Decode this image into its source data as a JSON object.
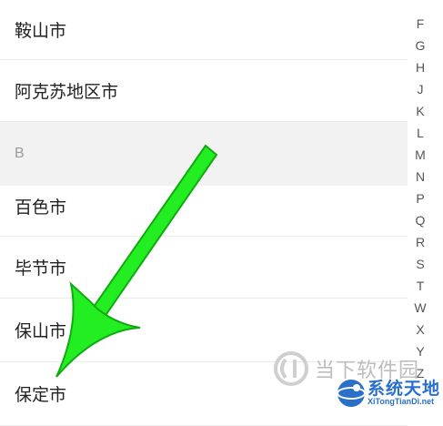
{
  "cities_a": [
    "鞍山市",
    "阿克苏地区市"
  ],
  "section_b": "B",
  "cities_b": [
    "百色市",
    "毕节市",
    "保山市",
    "保定市"
  ],
  "index_letters": [
    "F",
    "G",
    "H",
    "J",
    "K",
    "L",
    "M",
    "N",
    "P",
    "Q",
    "R",
    "S",
    "T",
    "W",
    "X",
    "Y",
    "Z"
  ],
  "watermark_1": "当下软件园",
  "watermark_2": {
    "cn": "系统天地",
    "en": "XiTongTianDi.net"
  },
  "colors": {
    "arrow": "#22ee22",
    "arrow_stroke": "#11aa11",
    "section_bg": "#f2f2f2"
  }
}
